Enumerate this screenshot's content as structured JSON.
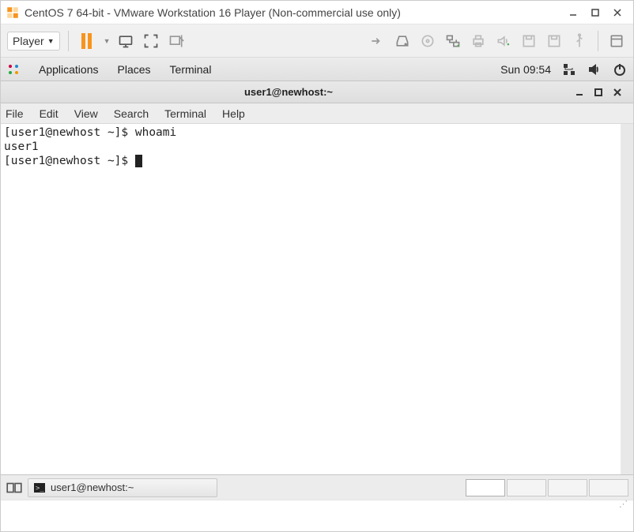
{
  "vmware": {
    "window_title": "CentOS 7 64-bit - VMware Workstation 16 Player (Non-commercial use only)",
    "player_label": "Player"
  },
  "gnome_top": {
    "applications": "Applications",
    "places": "Places",
    "terminal": "Terminal",
    "clock": "Sun 09:54"
  },
  "terminal_window": {
    "title": "user1@newhost:~",
    "menu": {
      "file": "File",
      "edit": "Edit",
      "view": "View",
      "search": "Search",
      "terminal": "Terminal",
      "help": "Help"
    },
    "lines": [
      "[user1@newhost ~]$ whoami",
      "user1",
      "[user1@newhost ~]$ "
    ]
  },
  "taskbar": {
    "active_task": "user1@newhost:~"
  }
}
